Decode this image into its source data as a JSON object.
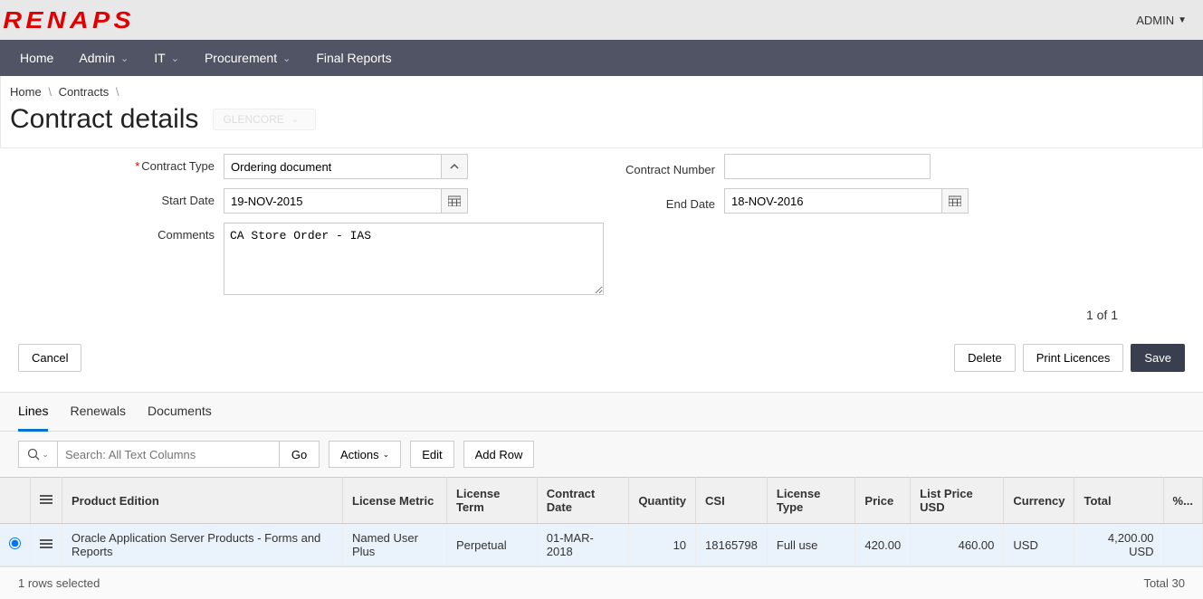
{
  "header": {
    "logo": "RENAPS",
    "user_menu": "ADMIN"
  },
  "nav": {
    "items": [
      "Home",
      "Admin",
      "IT",
      "Procurement",
      "Final Reports"
    ],
    "has_submenu": [
      false,
      true,
      true,
      true,
      false
    ]
  },
  "breadcrumb": {
    "items": [
      "Home",
      "Contracts"
    ]
  },
  "page": {
    "title": "Contract details",
    "org": "GLENCORE"
  },
  "form": {
    "contract_type_label": "Contract Type",
    "contract_type_value": "Ordering document",
    "contract_number_label": "Contract Number",
    "contract_number_value": "",
    "start_date_label": "Start Date",
    "start_date_value": "19-NOV-2015",
    "end_date_label": "End Date",
    "end_date_value": "18-NOV-2016",
    "comments_label": "Comments",
    "comments_value": "CA Store Order - IAS"
  },
  "counter": "1 of 1",
  "buttons": {
    "cancel": "Cancel",
    "delete": "Delete",
    "print": "Print Licences",
    "save": "Save"
  },
  "tabs": {
    "items": [
      "Lines",
      "Renewals",
      "Documents"
    ],
    "active": 0
  },
  "toolbar": {
    "search_placeholder": "Search: All Text Columns",
    "go": "Go",
    "actions": "Actions",
    "edit": "Edit",
    "add_row": "Add Row"
  },
  "grid": {
    "columns": [
      "",
      "",
      "Product Edition",
      "License Metric",
      "License Term",
      "Contract Date",
      "Quantity",
      "CSI",
      "License Type",
      "Price",
      "List Price USD",
      "Currency",
      "Total",
      "%..."
    ],
    "rows": [
      {
        "product_edition": "Oracle Application Server Products - Forms and Reports",
        "license_metric": "Named User Plus",
        "license_term": "Perpetual",
        "contract_date": "01-MAR-2018",
        "quantity": "10",
        "csi": "18165798",
        "license_type": "Full use",
        "price": "420.00",
        "list_price_usd": "460.00",
        "currency": "USD",
        "total": "4,200.00 USD",
        "pct": ""
      }
    ],
    "footer_left": "1 rows selected",
    "footer_right": "Total 30"
  }
}
